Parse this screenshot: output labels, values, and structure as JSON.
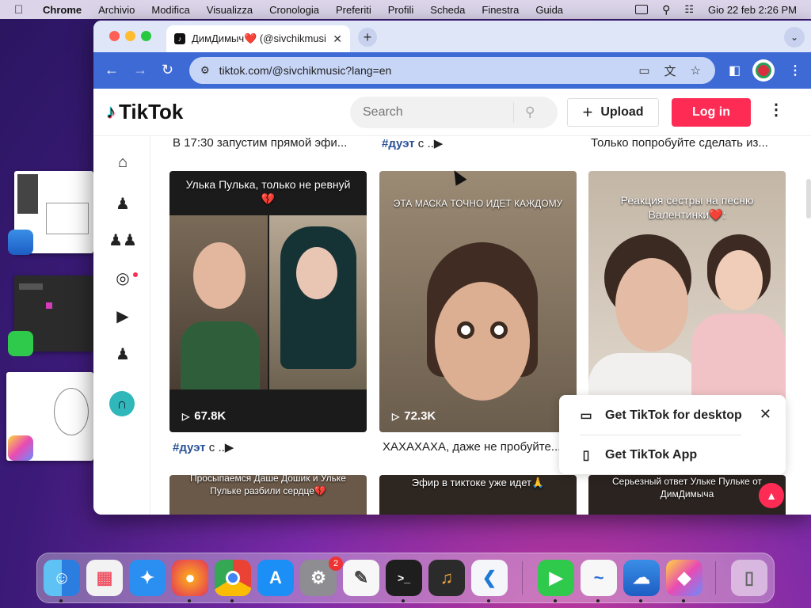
{
  "menubar": {
    "app": "Chrome",
    "items": [
      "Archivio",
      "Modifica",
      "Visualizza",
      "Cronologia",
      "Preferiti",
      "Profili",
      "Scheda",
      "Finestra",
      "Guida"
    ],
    "datetime": "Gio 22 feb  2:26 PM"
  },
  "browser": {
    "tab_title": "ДимДимыч❤️ (@sivchikmusi",
    "url": "tiktok.com/@sivchikmusic?lang=en"
  },
  "tiktok": {
    "brand": "TikTok",
    "search_placeholder": "Search",
    "upload_label": "Upload",
    "login_label": "Log in",
    "top_captions": [
      "В 17:30 запустим прямой эфи...",
      "#дуэт",
      " с ..▶",
      "Только попробуйте сделать из..."
    ],
    "videos": [
      {
        "overlay": "Улька Пулька, только не ревнуй💔",
        "views": "67.8K",
        "caption_tag": "#дуэт",
        "caption_text": " с ..▶"
      },
      {
        "overlay": "ЭТА МАСКА ТОЧНО ИДЕТ КАЖДОМУ",
        "views": "72.3K",
        "caption_text": "ХАХАХАХА, даже не пробуйте..."
      },
      {
        "overlay": "Реакция сестры на песню Валентинки❤️:",
        "views": "",
        "caption_text": ""
      }
    ],
    "row2_overlays": [
      "Просыпаемся Даше Дошик и Ульке Пульке разбили сердце💔",
      "Эфир в тиктоке уже идет🙏",
      "Серьезный ответ Ульке Пульке от ДимДимыча"
    ],
    "popup": {
      "desktop_label": "Get TikTok for desktop",
      "app_label": "Get TikTok App"
    }
  },
  "dock": {
    "settings_badge": "2"
  },
  "colors": {
    "tiktok_red": "#fe2c55",
    "chrome_blue": "#3e6ad6",
    "hashtag": "#2b5397"
  }
}
